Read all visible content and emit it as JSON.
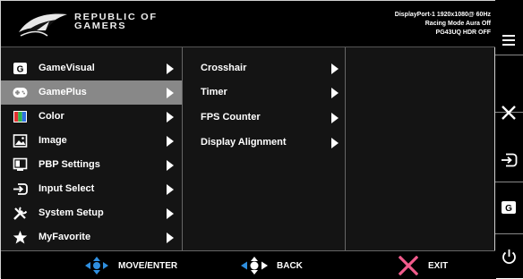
{
  "header": {
    "brand_line1": "REPUBLIC OF",
    "brand_line2": "GAMERS",
    "status_line1": "DisplayPort-1 1920x1080@ 60Hz",
    "status_line2": "Racing Mode Aura Off",
    "status_line3": "PG43UQ HDR OFF"
  },
  "main_menu": [
    {
      "label": "GameVisual",
      "icon": "gamevisual-icon",
      "selected": false
    },
    {
      "label": "GamePlus",
      "icon": "gameplus-icon",
      "selected": true
    },
    {
      "label": "Color",
      "icon": "color-icon",
      "selected": false
    },
    {
      "label": "Image",
      "icon": "image-icon",
      "selected": false
    },
    {
      "label": "PBP Settings",
      "icon": "pbp-settings-icon",
      "selected": false
    },
    {
      "label": "Input Select",
      "icon": "input-select-icon",
      "selected": false
    },
    {
      "label": "System Setup",
      "icon": "system-setup-icon",
      "selected": false
    },
    {
      "label": "MyFavorite",
      "icon": "star-icon",
      "selected": false
    }
  ],
  "sub_menu": [
    {
      "label": "Crosshair"
    },
    {
      "label": "Timer"
    },
    {
      "label": "FPS Counter"
    },
    {
      "label": "Display Alignment"
    }
  ],
  "footer": {
    "move_label": "MOVE/ENTER",
    "back_label": "BACK",
    "exit_label": "EXIT"
  },
  "hotkeys": [
    "menu-icon",
    "close-icon",
    "input-icon",
    "gamevisual-key-icon",
    "power-icon"
  ],
  "colors": {
    "background": "#141414",
    "selected_row": "#888888",
    "text": "#ffffff",
    "nav_blue": "#2f8fe0",
    "exit_pink": "#f25b8c"
  }
}
